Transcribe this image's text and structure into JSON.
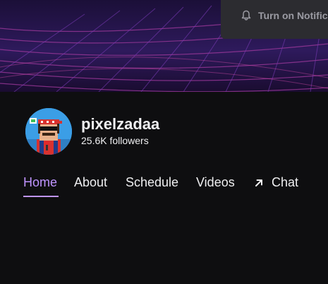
{
  "notification": {
    "label": "Turn on Notifications",
    "icon": "bell-icon"
  },
  "channel": {
    "name": "pixelzadaa",
    "followers": "25.6K followers",
    "avatar_icon": "avatar"
  },
  "tabs": [
    {
      "label": "Home",
      "active": true
    },
    {
      "label": "About",
      "active": false
    },
    {
      "label": "Schedule",
      "active": false
    },
    {
      "label": "Videos",
      "active": false
    },
    {
      "label": "Chat",
      "active": false,
      "icon": "external-arrow-icon"
    }
  ],
  "colors": {
    "background": "#0e0e10",
    "accent": "#bf94ff",
    "text": "#efeff1",
    "button_bg": "#2c2c30"
  }
}
